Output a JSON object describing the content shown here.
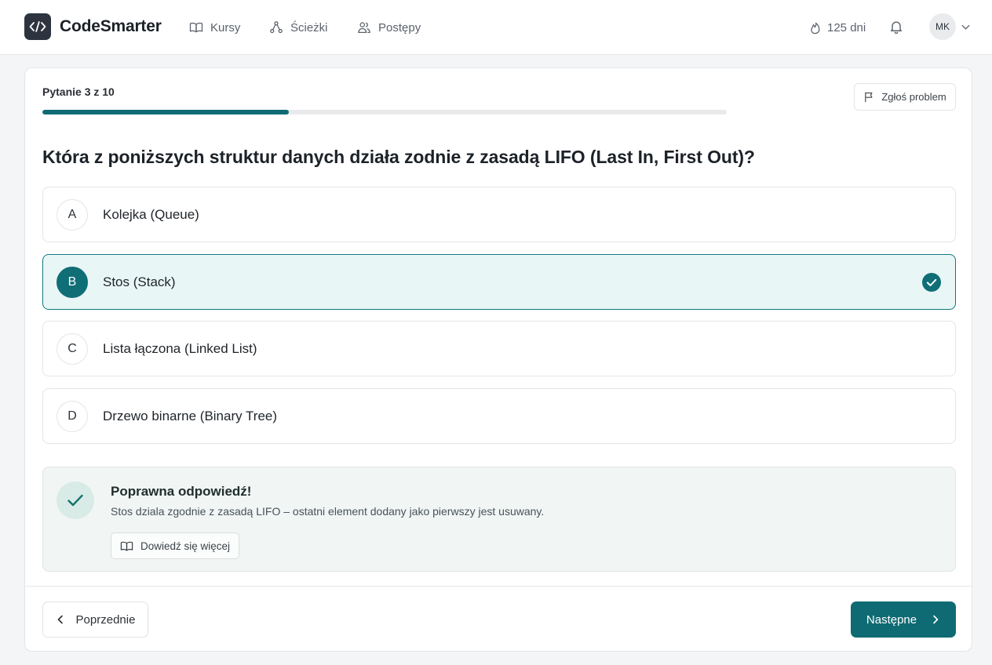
{
  "app": {
    "name": "CodeSmarter"
  },
  "nav": [
    {
      "label": "Kursy",
      "icon": "book-icon"
    },
    {
      "label": "Ścieżki",
      "icon": "paths-icon"
    },
    {
      "label": "Postępy",
      "icon": "progress-icon"
    }
  ],
  "header": {
    "streak": "125 dni",
    "streak_icon": "flame-icon",
    "notifications_icon": "bell-icon",
    "avatar_initials": "MK"
  },
  "quiz": {
    "counter": "Pytanie 3 z 10",
    "progress_fraction": 0.3,
    "report_label": "Zgłoś problem",
    "question": "Która z poniższych struktur danych działa zodnie z zasadą LIFO (Last In, First Out)?",
    "options": [
      {
        "letter": "A",
        "text": "Kolejka (Queue)",
        "selected": false
      },
      {
        "letter": "B",
        "text": "Stos (Stack)",
        "selected": true
      },
      {
        "letter": "C",
        "text": "Lista łączona (Linked List)",
        "selected": false
      },
      {
        "letter": "D",
        "text": "Drzewo binarne (Binary Tree)",
        "selected": false
      }
    ]
  },
  "feedback": {
    "title": "Poprawna odpowiedź!",
    "text": "Stos dziala zgodnie z zasadą LIFO – ostatni element dodany jako pierwszy jest usuwany.",
    "learn_more": "Dowiedź się więcej"
  },
  "footer": {
    "prev_label": "Poprzednie",
    "next_label": "Następne"
  },
  "colors": {
    "accent": "#0f6b73",
    "selected_bg": "#e8f6f6",
    "feedback_bg": "#f1f5f4"
  }
}
